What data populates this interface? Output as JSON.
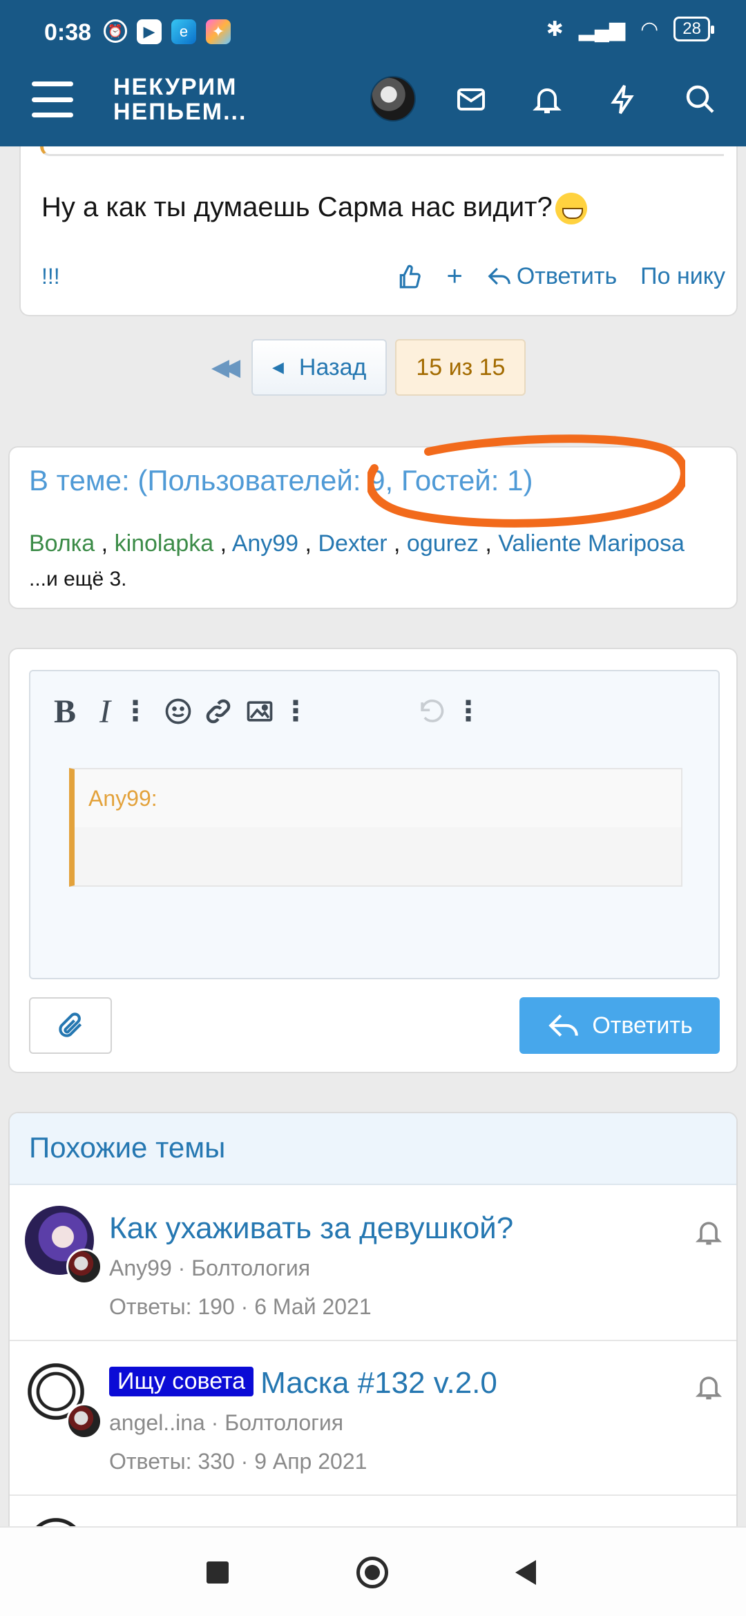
{
  "status": {
    "time": "0:38",
    "battery": "28"
  },
  "header": {
    "logo_line1": "НЕКУРИМ",
    "logo_line2": "НЕПЬЕМ..."
  },
  "post": {
    "text": "Ну а как ты думаешь Сарма нас видит?",
    "reaction_label": "!!!",
    "reply_label": "Ответить",
    "by_nick_label": "По нику",
    "plus_label": "+"
  },
  "pagination": {
    "back_label": "Назад",
    "current": "15 из 15"
  },
  "online": {
    "title": "В теме: (Пользователей: 9, Гостей: 1)",
    "users": [
      "Волка",
      "kinolapka",
      "Any99",
      "Dexter",
      "ogurez",
      "Valiente Mariposa"
    ],
    "more": "...и ещё 3."
  },
  "editor": {
    "quote_author": "Any99:",
    "reply_button": "Ответить"
  },
  "similar": {
    "heading": "Похожие темы",
    "threads": [
      {
        "prefix": "",
        "title": "Как ухаживать за девушкой?",
        "meta": "Any99 · Болтология",
        "stats": "Ответы: 190 · 6 Май 2021"
      },
      {
        "prefix": "Ищу совета",
        "title": "Маска #132 v.2.0",
        "meta": "angel..ina · Болтология",
        "stats": "Ответы: 330 · 9 Апр 2021"
      }
    ]
  },
  "colors": {
    "header": "#185886",
    "link": "#2577b1",
    "accent": "#47a7eb",
    "quote": "#e3a23b",
    "annotation": "#f26a1b"
  }
}
